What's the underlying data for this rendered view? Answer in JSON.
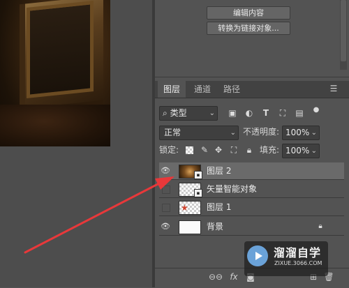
{
  "properties_panel": {
    "edit_contents_label": "编辑内容",
    "convert_to_linked_label": "转换为链接对象..."
  },
  "layers_panel": {
    "tabs": [
      {
        "label": "图层",
        "active": true
      },
      {
        "label": "通道",
        "active": false
      },
      {
        "label": "路径",
        "active": false
      }
    ],
    "filter": {
      "selected": "类型"
    },
    "filter_icons": [
      "image-filter-icon",
      "adjustment-filter-icon",
      "type-filter-icon",
      "shape-filter-icon",
      "smart-object-filter-icon",
      "filter-toggle-icon"
    ],
    "blend_mode": "正常",
    "opacity_label": "不透明度:",
    "opacity_value": "100%",
    "lock_label": "锁定:",
    "fill_label": "填充:",
    "fill_value": "100%",
    "layers": [
      {
        "name": "图层 2",
        "visible": true,
        "selected": true,
        "type": "smart-object"
      },
      {
        "name": "矢量智能对象",
        "visible": false,
        "selected": false,
        "type": "smart-object"
      },
      {
        "name": "图层 1",
        "visible": false,
        "selected": false,
        "type": "pixel"
      },
      {
        "name": "背景",
        "visible": true,
        "selected": false,
        "type": "background",
        "locked": true
      }
    ]
  },
  "bottom_toolbar": {
    "link_icon_glyph": "⊖⊖",
    "fx_label": "fx"
  },
  "watermark": {
    "title": "溜溜自学",
    "url": "ZIXUE.3066.COM"
  },
  "annotation": {
    "arrow_color": "#e8383a"
  }
}
